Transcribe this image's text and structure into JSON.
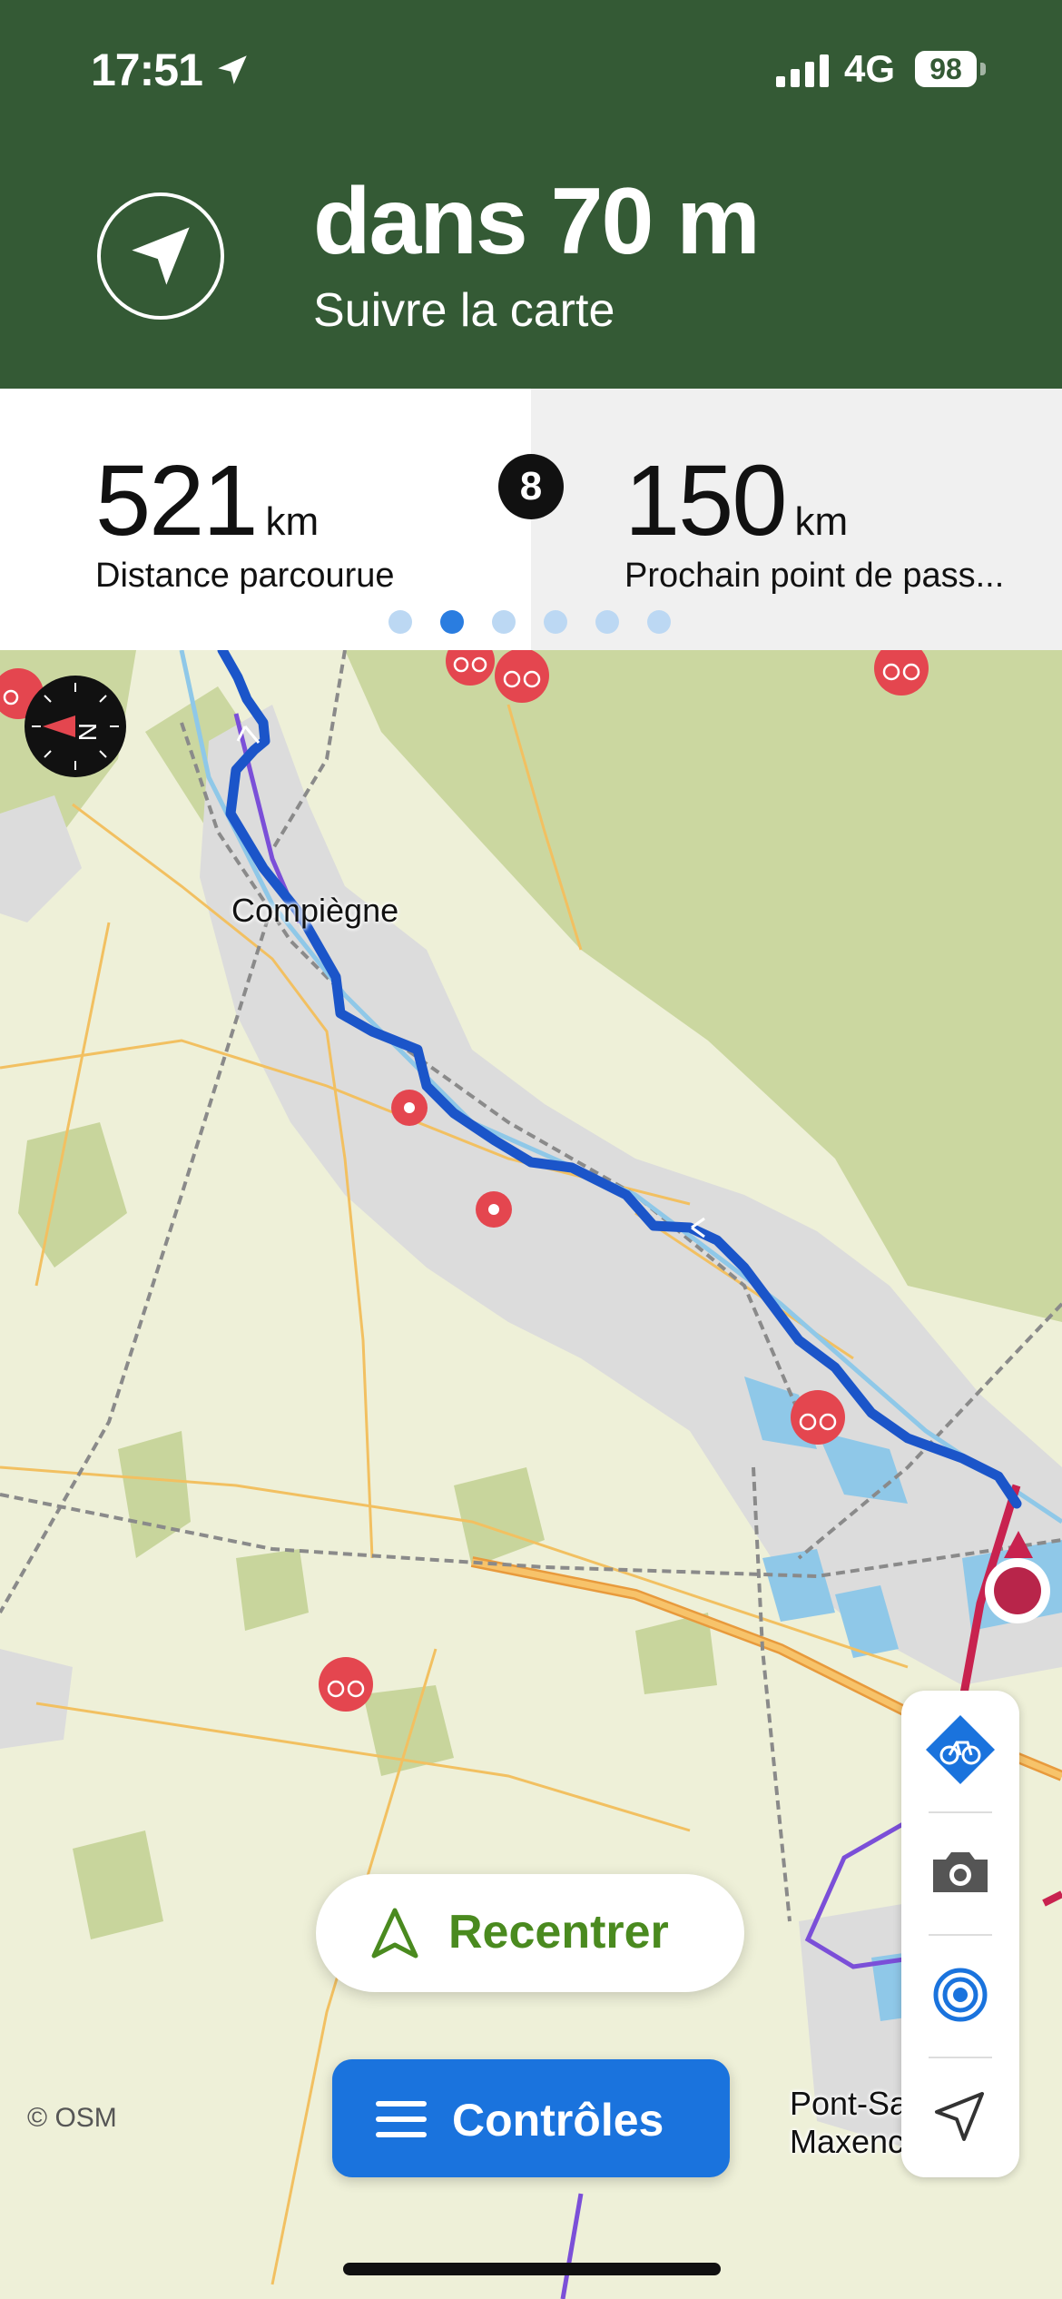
{
  "status": {
    "time": "17:51",
    "network": "4G",
    "battery": "98"
  },
  "instruction": {
    "distance": "dans 70 m",
    "text": "Suivre la carte"
  },
  "info": {
    "left": {
      "value": "521",
      "unit": "km",
      "label": "Distance parcourue"
    },
    "right": {
      "value": "150",
      "unit": "km",
      "label": "Prochain point de pass..."
    },
    "badge": "8",
    "page_dots": 6,
    "active_dot": 1
  },
  "map": {
    "city_labels": [
      "Compiègne",
      "Pont-Sainte-Maxence"
    ],
    "attribution": "© OSM",
    "colors": {
      "route": "#1b55c9",
      "poi": "#e4464f",
      "forest": "#cbd7a0",
      "urban": "#dcdcdc",
      "water": "#8fc8e8"
    }
  },
  "buttons": {
    "recenter": "Recentrer",
    "controls": "Contrôles"
  },
  "icons": {
    "compass": "compass-icon",
    "bike_mode": "bicycle-diamond-icon",
    "camera": "camera-icon",
    "broadcast": "broadcast-icon",
    "navigation": "navigation-arrow-icon"
  }
}
